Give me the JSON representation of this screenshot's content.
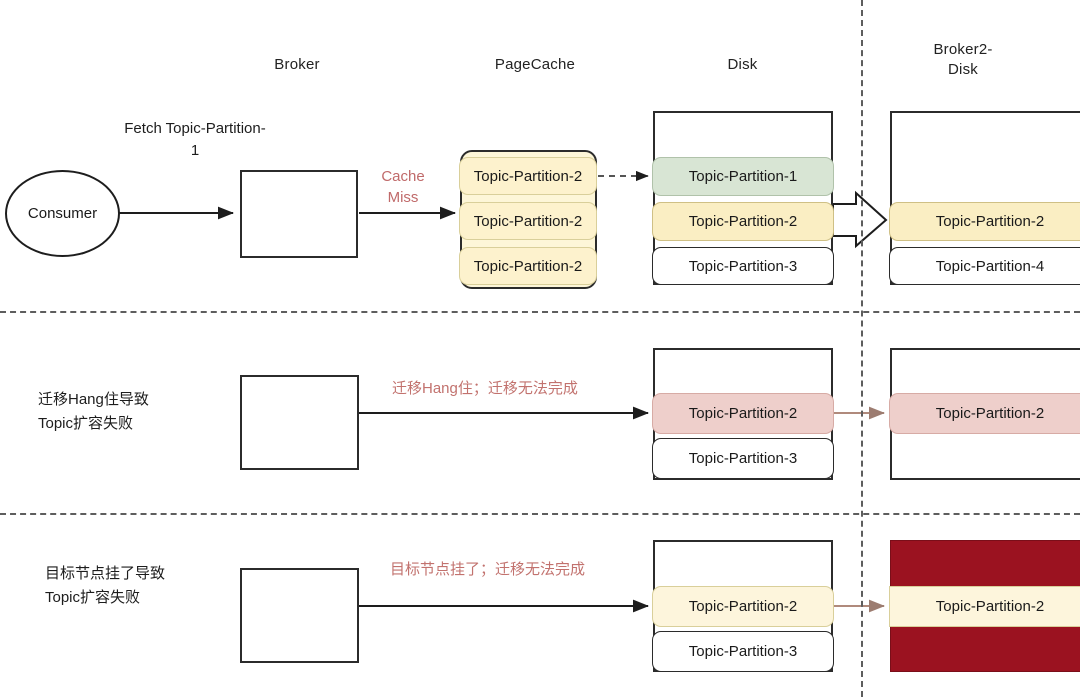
{
  "headers": {
    "broker": "Broker",
    "pagecache": "PageCache",
    "disk": "Disk",
    "broker2_disk": "Broker2-\nDisk"
  },
  "row1": {
    "fetch_label": "Fetch Topic-Partition-\n1",
    "consumer": "Consumer",
    "cache_miss": "Cache\nMiss",
    "pagecache_entries": [
      "Topic-Partition-2",
      "Topic-Partition-2",
      "Topic-Partition-2"
    ],
    "disk_entries": [
      "Topic-Partition-1",
      "Topic-Partition-2",
      "Topic-Partition-3"
    ],
    "broker2_entries": [
      "Topic-Partition-2",
      "Topic-Partition-4"
    ]
  },
  "row2": {
    "left_label": "迁移Hang住导致\nTopic扩容失败",
    "arrow_label": "迁移Hang住；迁移无法完成",
    "disk_entries": [
      "Topic-Partition-2",
      "Topic-Partition-3"
    ],
    "broker2_entries": [
      "Topic-Partition-2"
    ]
  },
  "row3": {
    "left_label": "目标节点挂了导致\nTopic扩容失败",
    "arrow_label": "目标节点挂了；迁移无法完成",
    "disk_entries": [
      "Topic-Partition-2",
      "Topic-Partition-3"
    ],
    "broker2_entries": [
      "Topic-Partition-2"
    ]
  },
  "colors": {
    "accent_red": "#c06a6a",
    "dead_node": "#9b1220",
    "cache_yellow": "#fdf2cd",
    "disk_green": "#d8e5d4",
    "hang_pink": "#eecfcb",
    "stroke": "#2b2b2b"
  }
}
